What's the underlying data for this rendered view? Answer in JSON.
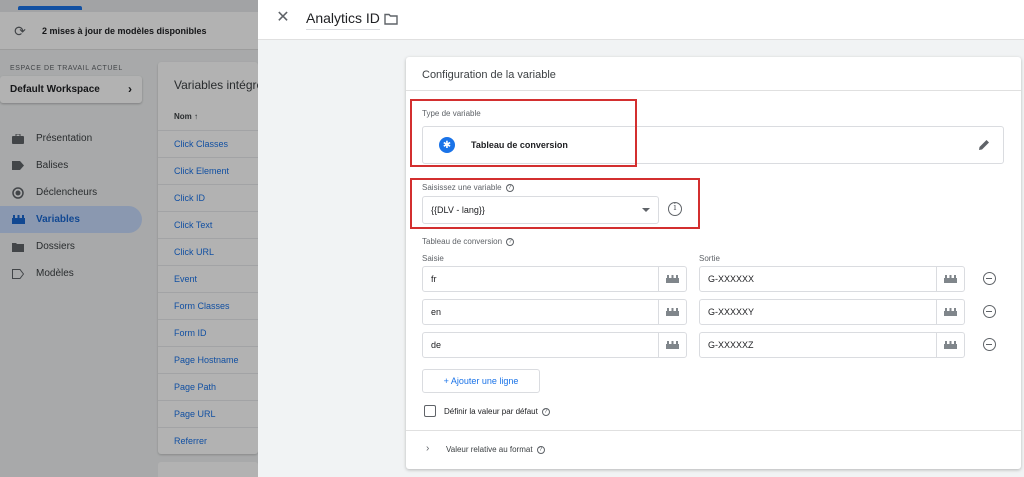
{
  "background": {
    "updates_text": "2 mises à jour de modèles disponibles",
    "workspace_label": "ESPACE DE TRAVAIL ACTUEL",
    "workspace_name": "Default Workspace",
    "nav": [
      {
        "label": "Présentation",
        "icon": "briefcase-icon",
        "active": false
      },
      {
        "label": "Balises",
        "icon": "tag-icon",
        "active": false
      },
      {
        "label": "Déclencheurs",
        "icon": "trigger-icon",
        "active": false
      },
      {
        "label": "Variables",
        "icon": "variables-icon",
        "active": true
      },
      {
        "label": "Dossiers",
        "icon": "folder-icon",
        "active": false
      },
      {
        "label": "Modèles",
        "icon": "template-icon",
        "active": false
      }
    ],
    "card_title": "Variables intégrées",
    "column_header": "Nom ↑",
    "rows": [
      "Click Classes",
      "Click Element",
      "Click ID",
      "Click Text",
      "Click URL",
      "Event",
      "Form Classes",
      "Form ID",
      "Page Hostname",
      "Page Path",
      "Page URL",
      "Referrer"
    ]
  },
  "panel": {
    "title": "Analytics ID",
    "config_title": "Configuration de la variable",
    "type_label": "Type de variable",
    "type_name": "Tableau de conversion",
    "input_var_label": "Saisissez une variable",
    "input_var_value": "{{DLV - lang}}",
    "table_label": "Tableau de conversion",
    "col_input": "Saisie",
    "col_output": "Sortie",
    "rows": [
      {
        "input": "fr",
        "output": "G-XXXXXX"
      },
      {
        "input": "en",
        "output": "G-XXXXXY"
      },
      {
        "input": "de",
        "output": "G-XXXXXZ"
      }
    ],
    "add_row_label": "+ Ajouter une ligne",
    "default_value_label": "Définir la valeur par défaut",
    "format_label": "Valeur relative au format"
  },
  "colors": {
    "accent": "#1a73e8",
    "highlight": "#d32f2f"
  }
}
